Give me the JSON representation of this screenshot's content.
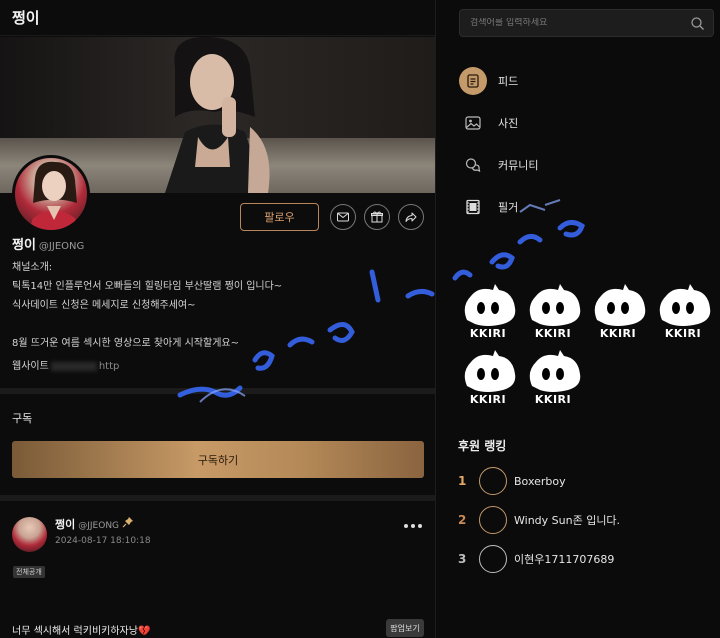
{
  "header": {
    "title": "쩡이"
  },
  "profile": {
    "name": "쩡이",
    "handle": "@JJEONG",
    "follow_label": "팔로우",
    "bio_heading": "채널소개:",
    "bio_line1": "틱톡14만 인플루언서 오빠들의 힐링타임 부산딸램 쩡이 입니다~",
    "bio_line2": "식사데이트 신청은 메세지로 신청해주세여~",
    "bio_line3": "8월 뜨거운 여름 섹시한 영상으로 찾아게 시작할게요~",
    "website_label": "웹사이트",
    "website_value": "http"
  },
  "subscribe": {
    "label": "구독",
    "button_label": "구독하기"
  },
  "post": {
    "author": "쩡이",
    "handle": "@JJEONG",
    "date": "2024-08-17 18:10:18",
    "visibility_badge": "전체공개",
    "text": "너무 섹시해서 럭키비키하자낭💔",
    "popup_label": "팝업보기"
  },
  "search": {
    "placeholder": "검색어를 입력하세요"
  },
  "nav": {
    "items": [
      {
        "label": "피드",
        "icon": "feed-icon",
        "active": true
      },
      {
        "label": "사진",
        "icon": "photo-icon"
      },
      {
        "label": "커뮤니티",
        "icon": "community-icon"
      },
      {
        "label": "필거",
        "icon": "film-icon"
      }
    ]
  },
  "stickers": {
    "brand": "KKIRI",
    "count": 6
  },
  "ranking": {
    "title": "후원 랭킹",
    "entries": [
      {
        "rank": "1",
        "name": "Boxerboy",
        "color": "#e3a86a"
      },
      {
        "rank": "2",
        "name": "Windy Sun존 입니다.",
        "color": "#c98a55"
      },
      {
        "rank": "3",
        "name": "이현우1711707689",
        "color": "#bdbdbd"
      }
    ]
  },
  "colors": {
    "accent": "#c49a6a",
    "gold_gradient_start": "#7a5a37",
    "gold_gradient_mid": "#c79a66",
    "watermark_blue": "#3a6cff"
  }
}
